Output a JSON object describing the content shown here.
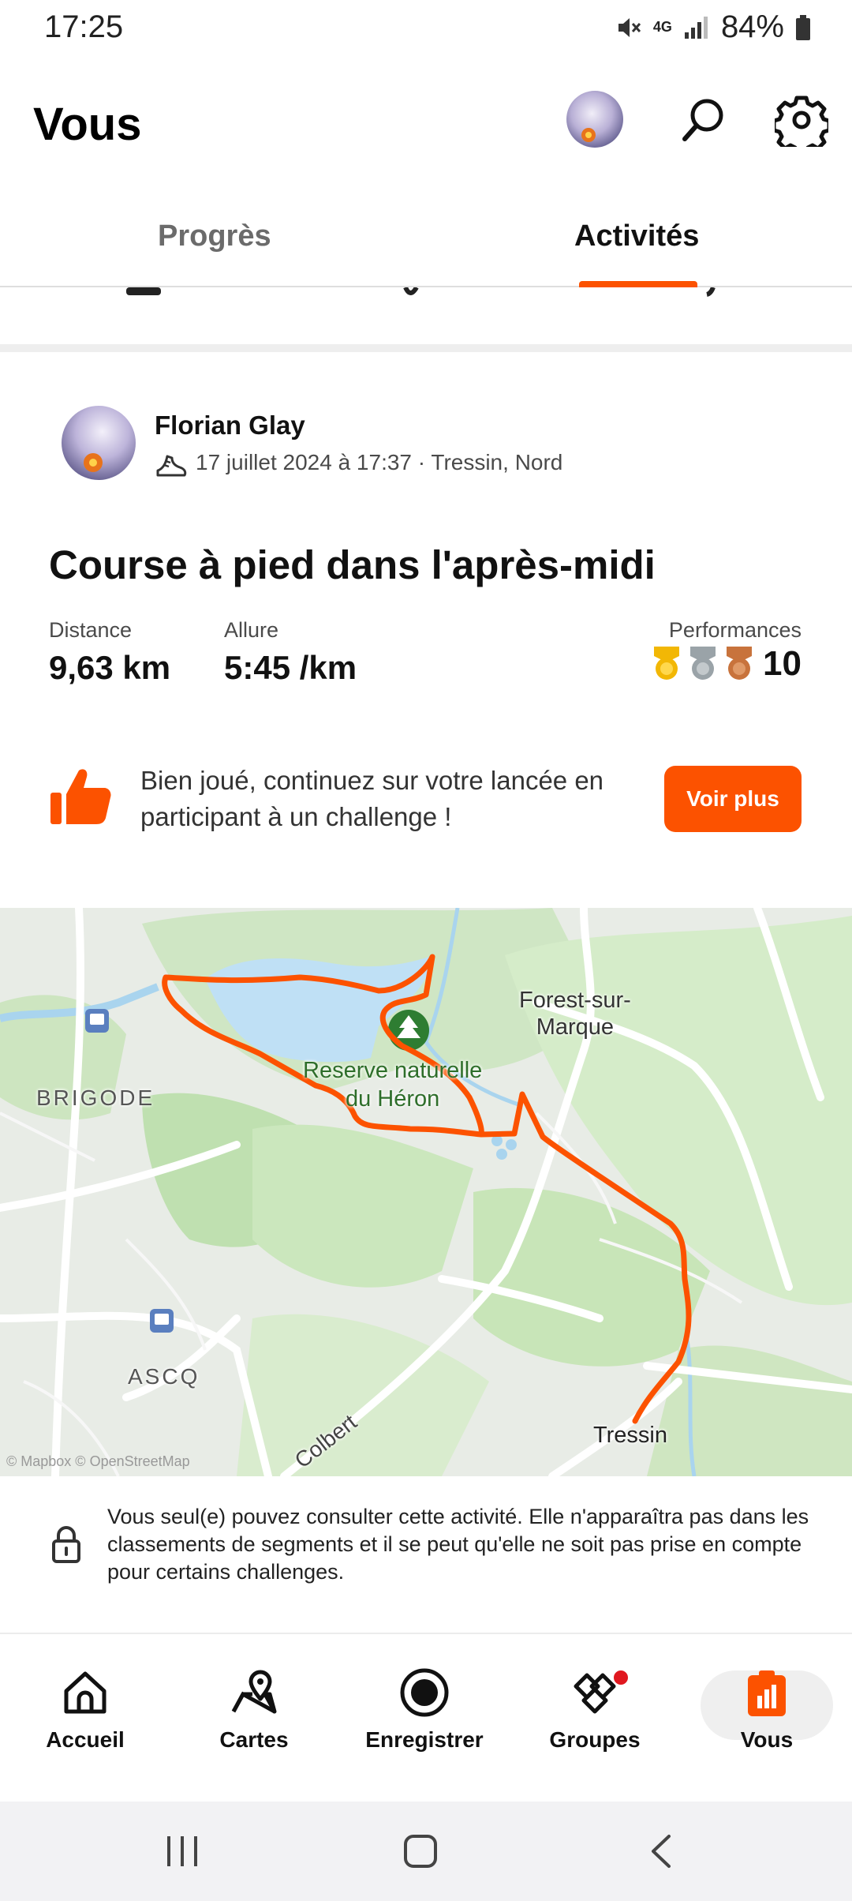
{
  "status_bar": {
    "time": "17:25",
    "battery": "84%",
    "network": "4G"
  },
  "header": {
    "title": "Vous"
  },
  "tabs": [
    {
      "label": "Progrès",
      "active": false
    },
    {
      "label": "Activités",
      "active": true
    }
  ],
  "activity": {
    "athlete_name": "Florian Glay",
    "meta": "17 juillet 2024 à 17:37 · Tressin, Nord",
    "title": "Course à pied dans l'après-midi",
    "stats": [
      {
        "label": "Distance",
        "value": "9,63 km"
      },
      {
        "label": "Allure",
        "value": "5:45 /km"
      }
    ],
    "performances": {
      "label": "Performances",
      "count": "10",
      "medal_colors": [
        "#f2b705",
        "#9aa3a8",
        "#c8733c"
      ]
    }
  },
  "promo": {
    "text": "Bien joué, continuez sur votre lancée en participant à un challenge !",
    "button": "Voir plus"
  },
  "map": {
    "labels": {
      "forest": "Forest-sur-\nMarque",
      "reserve": "Reserve naturelle\ndu Héron",
      "brigode": "BRIGODE",
      "ascq": "ASCQ",
      "tressin": "Tressin",
      "colbert": "Colbert"
    },
    "attribution": "© Mapbox © OpenStreetMap",
    "route_color": "#fc5200"
  },
  "privacy_notice": "Vous seul(e) pouvez consulter cette activité. Elle n'apparaîtra pas dans les classements de segments et il se peut qu'elle ne soit pas prise en compte pour certains challenges.",
  "bottom_nav": [
    {
      "label": "Accueil",
      "icon": "home-icon",
      "active": false
    },
    {
      "label": "Cartes",
      "icon": "map-icon",
      "active": false
    },
    {
      "label": "Enregistrer",
      "icon": "record-icon",
      "active": false
    },
    {
      "label": "Groupes",
      "icon": "groups-icon",
      "active": false,
      "badge": true
    },
    {
      "label": "Vous",
      "icon": "you-icon",
      "active": true
    }
  ],
  "colors": {
    "accent": "#fc5200"
  }
}
